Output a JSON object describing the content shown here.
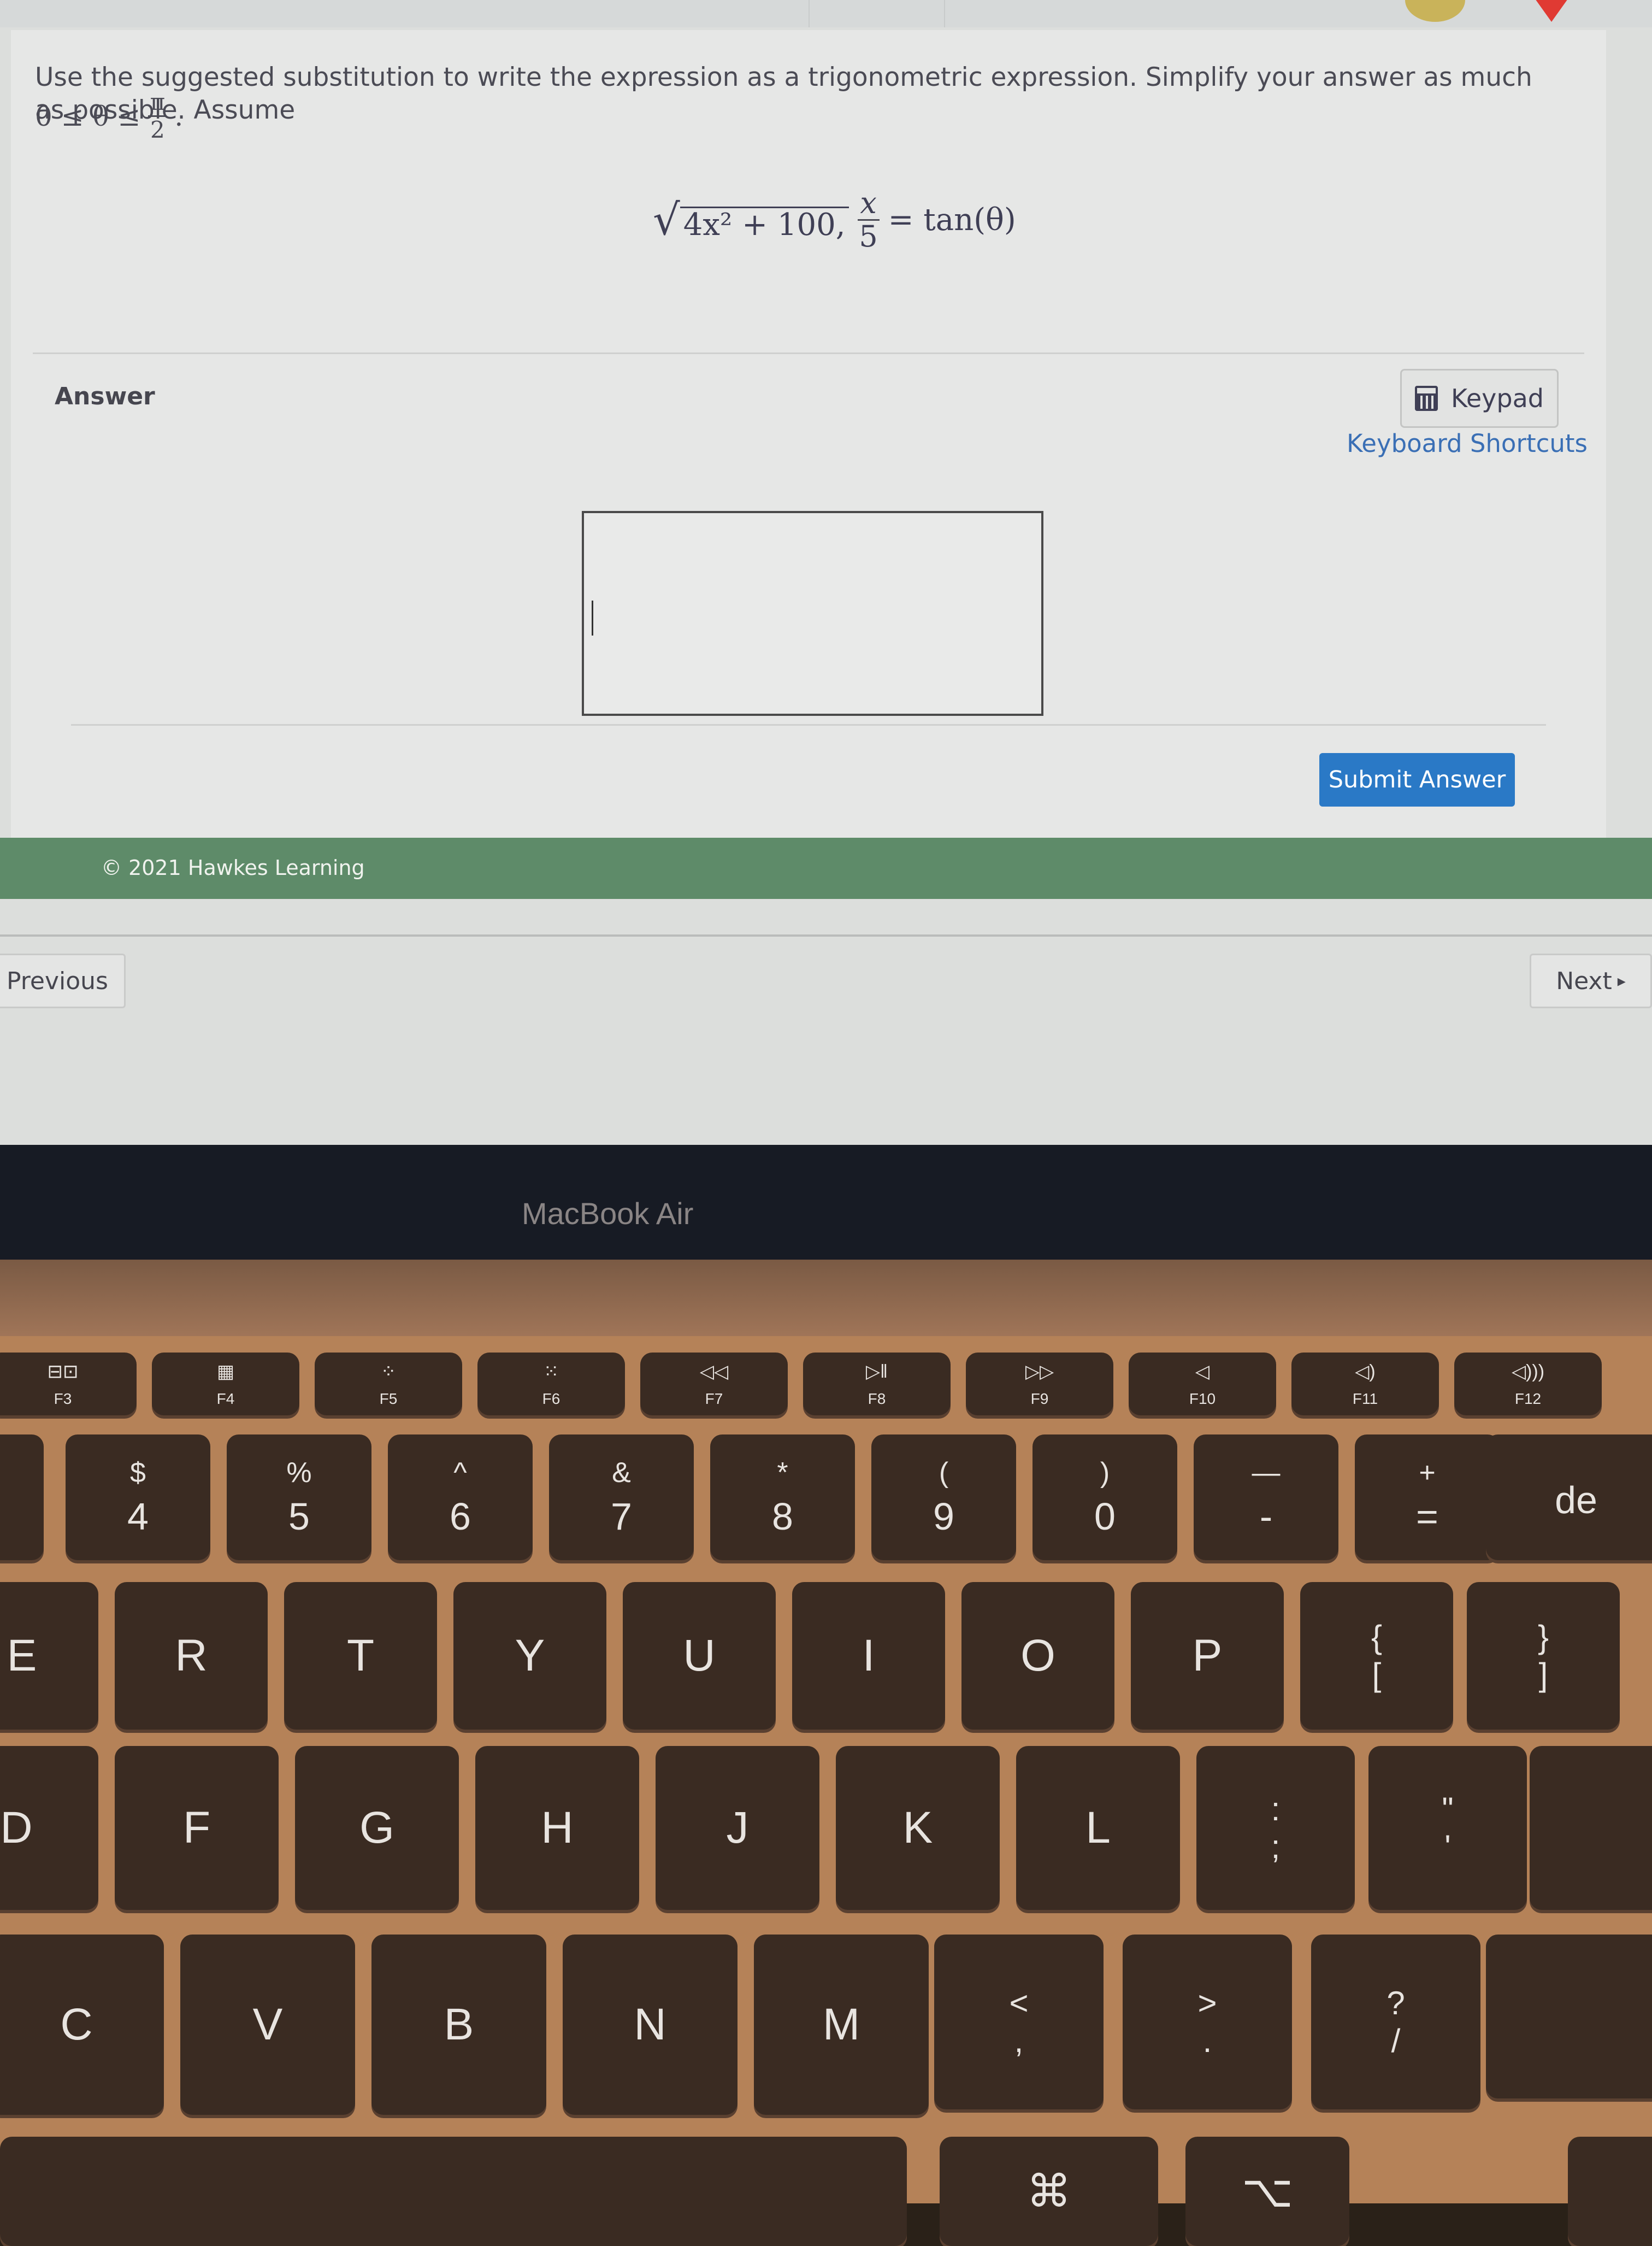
{
  "question": {
    "prompt": "Use the suggested substitution to write the expression as a trigonometric expression. Simplify your answer as much as possible. Assume",
    "assumption": {
      "left": "0 ≤ θ ≤",
      "numerator": "π",
      "denominator": "2",
      "trail": "."
    },
    "formula": {
      "radicand": "4x² + 100,",
      "numerator": "x",
      "denominator": "5",
      "rhs": "= tan(θ)"
    }
  },
  "answer": {
    "label": "Answer",
    "keypad_label": "Keypad",
    "keyboard_shortcuts_label": "Keyboard Shortcuts",
    "input_value": "",
    "submit_label": "Submit Answer"
  },
  "footer": {
    "copyright": "© 2021 Hawkes Learning"
  },
  "navigation": {
    "previous_label": "Previous",
    "next_label": "Next",
    "next_icon": "▸"
  },
  "colors": {
    "accent": "#2a79c6",
    "footer_band": "#5e8b69",
    "link": "#3a6fb5"
  },
  "laptop": {
    "brand": "MacBook Air",
    "function_row": [
      {
        "icon": "⊟⊡",
        "label": "F3",
        "name": "mission-control"
      },
      {
        "icon": "▦",
        "label": "F4",
        "name": "launchpad"
      },
      {
        "icon": "⁘",
        "label": "F5",
        "name": "keyboard-light-down"
      },
      {
        "icon": "⁙",
        "label": "F6",
        "name": "keyboard-light-up"
      },
      {
        "icon": "◁◁",
        "label": "F7",
        "name": "rewind"
      },
      {
        "icon": "▷‖",
        "label": "F8",
        "name": "play-pause"
      },
      {
        "icon": "▷▷",
        "label": "F9",
        "name": "fast-forward"
      },
      {
        "icon": "◁",
        "label": "F10",
        "name": "mute"
      },
      {
        "icon": "◁)",
        "label": "F11",
        "name": "volume-down"
      },
      {
        "icon": "◁)))",
        "label": "F12",
        "name": "volume-up"
      }
    ],
    "number_row": [
      {
        "shift": "$",
        "main": "4"
      },
      {
        "shift": "%",
        "main": "5"
      },
      {
        "shift": "^",
        "main": "6"
      },
      {
        "shift": "&",
        "main": "7"
      },
      {
        "shift": "*",
        "main": "8"
      },
      {
        "shift": "(",
        "main": "9"
      },
      {
        "shift": ")",
        "main": "0"
      },
      {
        "shift": "—",
        "main": "-"
      },
      {
        "shift": "+",
        "main": "="
      }
    ],
    "delete_partial": "de",
    "top_row": [
      "E",
      "R",
      "T",
      "Y",
      "U",
      "I",
      "O",
      "P"
    ],
    "top_row_punct": [
      {
        "shift": "{",
        "main": "["
      },
      {
        "shift": "}",
        "main": "]"
      }
    ],
    "home_row": [
      "D",
      "F",
      "G",
      "H",
      "J",
      "K",
      "L"
    ],
    "home_row_punct": [
      {
        "shift": ":",
        "main": ";"
      },
      {
        "shift": "\"",
        "main": "'"
      }
    ],
    "bottom_row": [
      "C",
      "V",
      "B",
      "N",
      "M"
    ],
    "bottom_row_punct": [
      {
        "shift": "<",
        "main": ","
      },
      {
        "shift": ">",
        "main": "."
      },
      {
        "shift": "?",
        "main": "/"
      }
    ],
    "command_symbol": "⌘",
    "option_symbol": "⌥"
  }
}
